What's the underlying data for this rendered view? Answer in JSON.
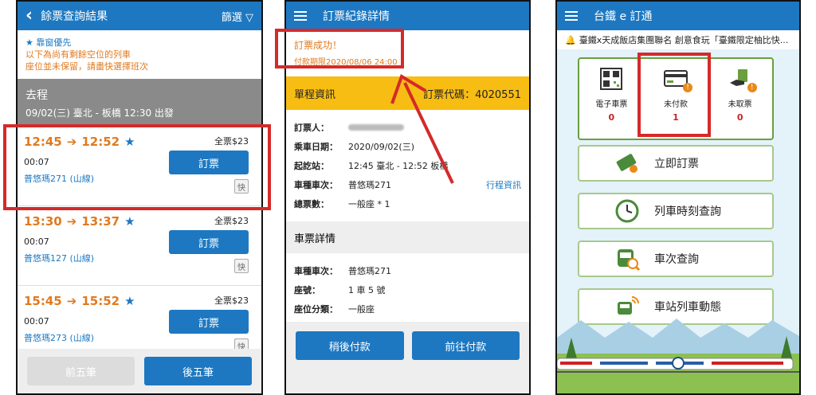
{
  "panel1": {
    "title": "餘票查詢結果",
    "filter": "篩選 ▽",
    "notice_line1": "★ 靠窗優先",
    "notice_line2": "以下為尚有剩餘空位的列車",
    "notice_line3": "座位並未保留，請盡快選擇班次",
    "trip_label": "去程",
    "trip_detail": "09/02(三) 臺北 - 板橋 12:30 出發",
    "trains": [
      {
        "depart": "12:45",
        "arrive": "12:52",
        "price": "全票$23",
        "duration": "00:07",
        "train_no": "普悠瑪271 (山線)",
        "book": "訂票",
        "fast": "快"
      },
      {
        "depart": "13:30",
        "arrive": "13:37",
        "price": "全票$23",
        "duration": "00:07",
        "train_no": "普悠瑪127 (山線)",
        "book": "訂票",
        "fast": "快"
      },
      {
        "depart": "15:45",
        "arrive": "15:52",
        "price": "全票$23",
        "duration": "00:07",
        "train_no": "普悠瑪273 (山線)",
        "book": "訂票",
        "fast": "快"
      }
    ],
    "prev_label": "前五筆",
    "next_label": "後五筆"
  },
  "panel2": {
    "title": "訂票紀錄詳情",
    "success": "訂票成功！",
    "deadline": "付款期限2020/08/06 24:00",
    "trip_info": "單程資訊",
    "code_label": "訂票代碼：",
    "code": "4020551",
    "rows": [
      {
        "k": "訂票人：",
        "v": ""
      },
      {
        "k": "乘車日期：",
        "v": "2020/09/02(三)"
      },
      {
        "k": "起訖站：",
        "v": "12:45 臺北 - 12:52 板橋"
      },
      {
        "k": "車種車次：",
        "v": "普悠瑪271"
      },
      {
        "k": "總票數：",
        "v": "一般座 * 1"
      }
    ],
    "trip_link": "行程資訊",
    "ticket_detail": "車票詳情",
    "ticket_rows": [
      {
        "k": "車種車次：",
        "v": "普悠瑪271"
      },
      {
        "k": "座號：",
        "v": "1 車 5 號"
      },
      {
        "k": "座位分類：",
        "v": "一般座"
      }
    ],
    "pay_later": "稍後付款",
    "pay_now": "前往付款"
  },
  "panel3": {
    "title": "台鐵 e 訂通",
    "marquee": "臺鐵x天成飯店集團聯名 創意食玩「臺鐵限定柚比快...",
    "status": [
      {
        "label": "電子車票",
        "count": "0"
      },
      {
        "label": "未付款",
        "count": "1"
      },
      {
        "label": "未取票",
        "count": "0"
      }
    ],
    "menu": [
      "立即訂票",
      "列車時刻查詢",
      "車次查詢",
      "車站列車動態"
    ]
  },
  "colors": {
    "primary": "#1d78c1",
    "accent": "#e07a1f",
    "highlight": "#d42a2a",
    "yellow": "#f8bd12"
  }
}
